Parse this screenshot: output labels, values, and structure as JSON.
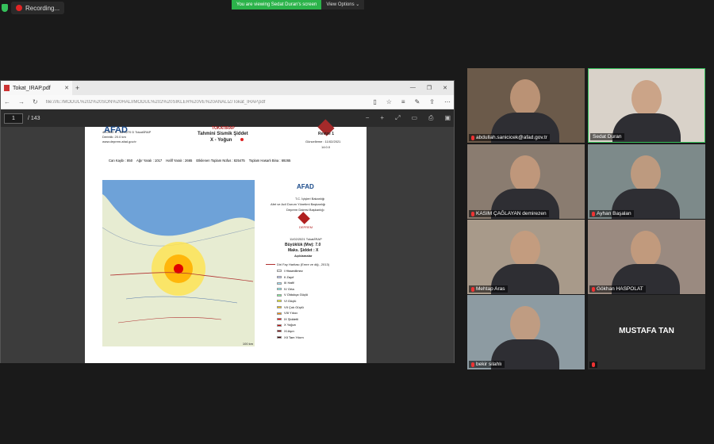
{
  "topbar": {
    "recording_label": "Recording...",
    "share_notice": "You are viewing Sedat Duran's screen",
    "view_options": "View Options"
  },
  "browser": {
    "tab_title": "Tokat_IRAP.pdf",
    "url": "file:///E:/MODÜL%202%20SON%20HALİ/MODÜL%202%20SİKLER%20VE%20ANALİZ/Tokat_IRAP.pdf",
    "page_current": "1",
    "page_total": "/ 143"
  },
  "document": {
    "org": "AFAD",
    "header_lines": [
      "TOKATIRAP",
      "Tahmini Sismik Şiddet",
      "X - Yoğun"
    ],
    "revision": "Revize 1",
    "updated": "Güncelleme : 11/02/2021",
    "time": "14:0.0",
    "coords_left": [
      "40.0952 K  -  36.5270 D  Tokat/İRAP",
      "Derinlik: 20.0 km",
      "www.deprem.afad.gov.tr"
    ],
    "stats_line": {
      "can_kaybi": "Can Kaybı : 850",
      "agir_yarali": "Ağır Yaralı : 1017",
      "hafif_yarali": "Hafif Yaralı : 2665",
      "nufus": "Etkilenen Toplam Nüfus : 825475",
      "hasarli_bina": "Toplam Hasarlı Bina : 69265"
    },
    "afad_lines": [
      "AFAD",
      "T.C. İçişleri Bakanlığı",
      "Afet ve Acil Durum Yönetimi Başkanlığı",
      "Deprem Dairesi Başkanlığı",
      "DEPREM"
    ],
    "event": [
      "11/02/2021 Tokat/İRAP",
      "Büyüklük (Mw): 7.0",
      "Maks. Şiddet : X",
      "Açıklamalar"
    ],
    "fault_label": "Diri Fay Haritası (Emre ve diğ., 2013)",
    "legend": [
      {
        "label": "I Hissedilmez",
        "color": "#ffffff"
      },
      {
        "label": "II Zayıf",
        "color": "#bfccff"
      },
      {
        "label": "III Hafif",
        "color": "#a0e6ff"
      },
      {
        "label": "IV Orta",
        "color": "#80ffff"
      },
      {
        "label": "V Oldukça Güçlü",
        "color": "#7aff93"
      },
      {
        "label": "VI Güçlü",
        "color": "#ffff00"
      },
      {
        "label": "VII Çok Güçlü",
        "color": "#ffc800"
      },
      {
        "label": "VIII Yıkıcı",
        "color": "#ff9100"
      },
      {
        "label": "IX Şiddetli",
        "color": "#ff0000"
      },
      {
        "label": "X Yoğun",
        "color": "#c80000"
      },
      {
        "label": "XI Aşırı",
        "color": "#800000"
      },
      {
        "label": "XII Tam Yıkım",
        "color": "#400000"
      }
    ],
    "scale": "100 km"
  },
  "participants": [
    {
      "name": "abdullah.sanicicek@afad.gov.tr",
      "bg": "#6b5a4a",
      "active": false
    },
    {
      "name": "Sedat Duran",
      "bg": "#d9d2c9",
      "active": true
    },
    {
      "name": "KASIM ÇAĞLAYAN demirezen",
      "bg": "#8a7c70",
      "active": false
    },
    {
      "name": "Ayhan Başalan",
      "bg": "#7d8a8a",
      "active": false
    },
    {
      "name": "Mehtap Aras",
      "bg": "#a89a8a",
      "active": false
    },
    {
      "name": "Gökhan HASPOLAT",
      "bg": "#9a8a80",
      "active": false
    },
    {
      "name": "bekir silahlı",
      "bg": "#8d9ba2",
      "active": false
    },
    {
      "name": "MUSTAFA TAN",
      "bg": "#2d2d2d",
      "active": false
    }
  ]
}
